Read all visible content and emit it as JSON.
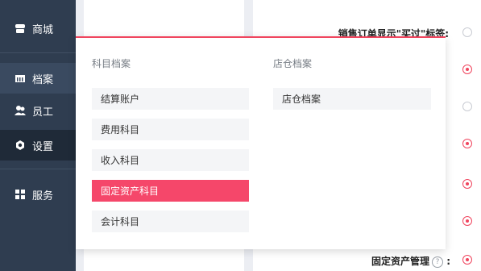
{
  "sidebar": {
    "items": [
      {
        "label": "商城",
        "icon": "store-icon"
      },
      {
        "label": "档案",
        "icon": "archive-icon"
      },
      {
        "label": "员工",
        "icon": "users-icon"
      },
      {
        "label": "设置",
        "icon": "gear-icon"
      },
      {
        "label": "服务",
        "icon": "grid-icon"
      }
    ]
  },
  "settings": {
    "show_bought_tag_label": "销售订单显示\"买过\"标签:",
    "fixed_assets_label": "固定资产管理",
    "help_glyph": "?",
    "colon": ":",
    "radios": [
      "off",
      "on",
      "off",
      "on",
      "on",
      "on",
      "on"
    ]
  },
  "dropdown": {
    "columns": [
      {
        "title": "科目档案",
        "items": [
          "结算账户",
          "费用科目",
          "收入科目",
          "固定资产科目",
          "会计科目"
        ],
        "active_index": 3
      },
      {
        "title": "店仓档案",
        "items": [
          "店仓档案"
        ]
      }
    ]
  },
  "colors": {
    "accent": "#f0455e",
    "sidebar": "#2f3d50",
    "active_item": "#f5476a"
  }
}
